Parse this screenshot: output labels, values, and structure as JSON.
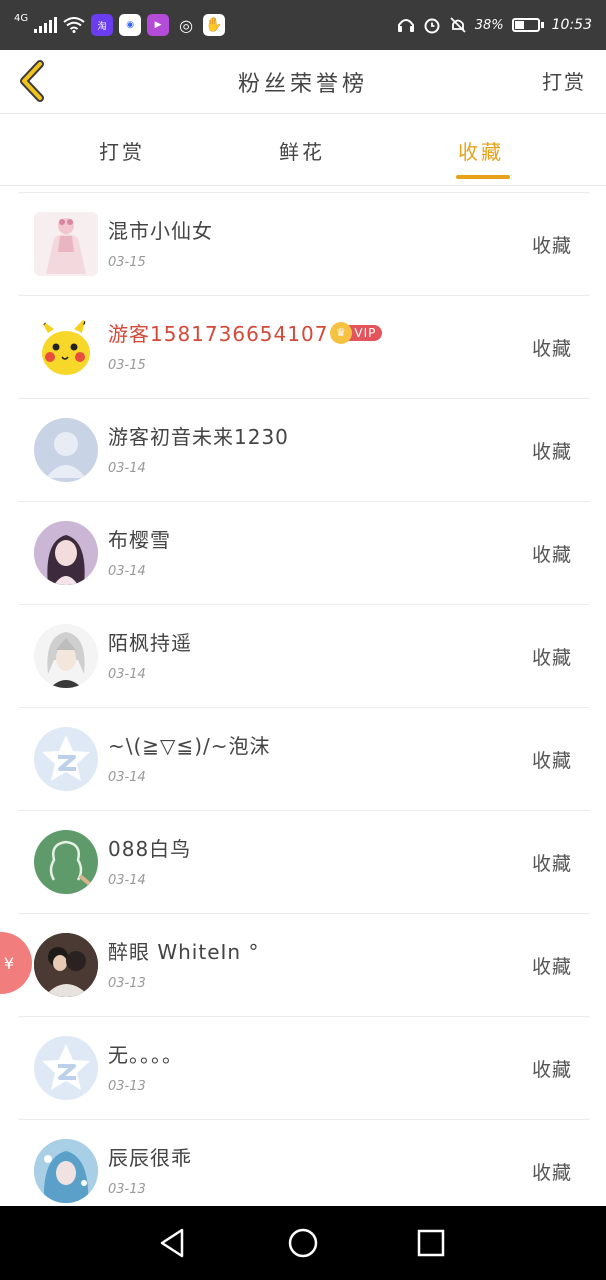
{
  "status_bar": {
    "network": "4G",
    "battery": "38%",
    "time": "10:53",
    "app_icons": [
      "taobao-icon",
      "baidu-icon",
      "video-icon",
      "wechat-icon",
      "paw-icon"
    ]
  },
  "header": {
    "title": "粉丝荣誉榜",
    "action_label": "打赏"
  },
  "tabs": [
    {
      "label": "打赏",
      "active": false
    },
    {
      "label": "鲜花",
      "active": false
    },
    {
      "label": "收藏",
      "active": true
    }
  ],
  "list": [
    {
      "name": "混市小仙女",
      "date": "03-15",
      "action": "收藏",
      "avatar": "pink-dress-avatar",
      "vip": false
    },
    {
      "name": "游客1581736654107",
      "date": "03-15",
      "action": "收藏",
      "avatar": "pikachu-avatar",
      "vip": true,
      "vip_label": "VIP"
    },
    {
      "name": "游客初音未来1230",
      "date": "03-14",
      "action": "收藏",
      "avatar": "default-person-avatar",
      "vip": false
    },
    {
      "name": "布樱雪",
      "date": "03-14",
      "action": "收藏",
      "avatar": "anime-girl-avatar",
      "vip": false
    },
    {
      "name": "陌枫持遥",
      "date": "03-14",
      "action": "收藏",
      "avatar": "silver-hair-avatar",
      "vip": false
    },
    {
      "name": "~\\(≧▽≦)/~泡沫",
      "date": "03-14",
      "action": "收藏",
      "avatar": "qzone-star-avatar",
      "vip": false
    },
    {
      "name": "088白鸟",
      "date": "03-14",
      "action": "收藏",
      "avatar": "chalkboard-avatar",
      "vip": false
    },
    {
      "name": "醉眼 WhiteIn °",
      "date": "03-13",
      "action": "收藏",
      "avatar": "photo-couple-avatar",
      "vip": false
    },
    {
      "name": "无。。。。",
      "date": "03-13",
      "action": "收藏",
      "avatar": "qzone-star-avatar",
      "vip": false
    },
    {
      "name": "辰辰很乖",
      "date": "03-13",
      "action": "收藏",
      "avatar": "blue-anime-avatar",
      "vip": false
    }
  ],
  "float_badge": {
    "symbol": "¥"
  },
  "colors": {
    "accent": "#e8a21a",
    "vip_name": "#d3493a",
    "status_bar": "#3b3b3b"
  }
}
